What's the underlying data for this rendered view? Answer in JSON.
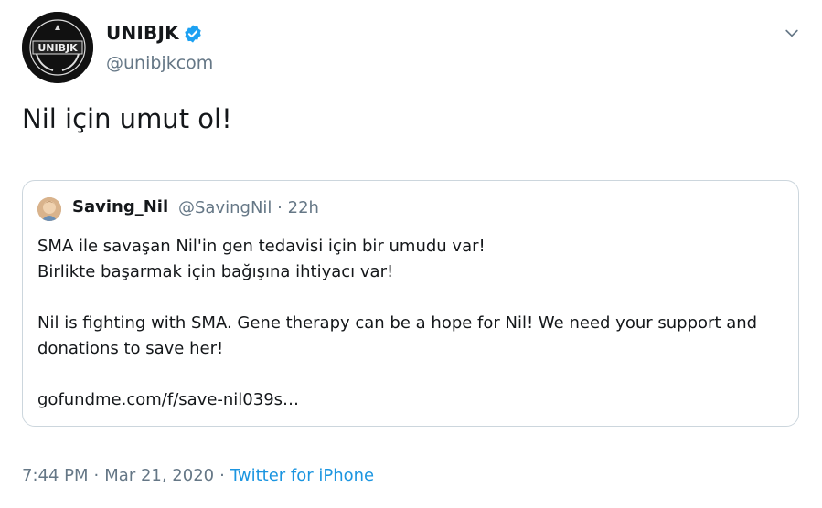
{
  "author": {
    "display_name": "UNIBJK",
    "handle": "@unibjkcom",
    "avatar_icon": "unibjk-logo-icon",
    "verified_icon": "verified-badge-icon",
    "avatar_text": "UNIBJK"
  },
  "menu": {
    "icon": "chevron-down-icon"
  },
  "tweet": {
    "text": "Nil için umut ol!"
  },
  "quote": {
    "display_name": "Saving_Nil",
    "handle": "@SavingNil",
    "separator": "·",
    "time": "22h",
    "lines": [
      "SMA ile savaşan Nil'in gen tedavisi için bir umudu var!",
      "Birlikte başarmak için bağışına ihtiyacı var!",
      "Nil is fighting with SMA. Gene therapy can be a hope for Nil! We need your support and donations to save her!",
      "gofundme.com/f/save-nil039s…"
    ]
  },
  "footer": {
    "time": "7:44 PM",
    "separator": "·",
    "date": "Mar 21, 2020",
    "source": "Twitter for iPhone"
  },
  "colors": {
    "text": "#14171a",
    "secondary": "#657786",
    "link": "#1b95e0",
    "verified": "#1da1f2",
    "border": "#ccd6dd"
  }
}
